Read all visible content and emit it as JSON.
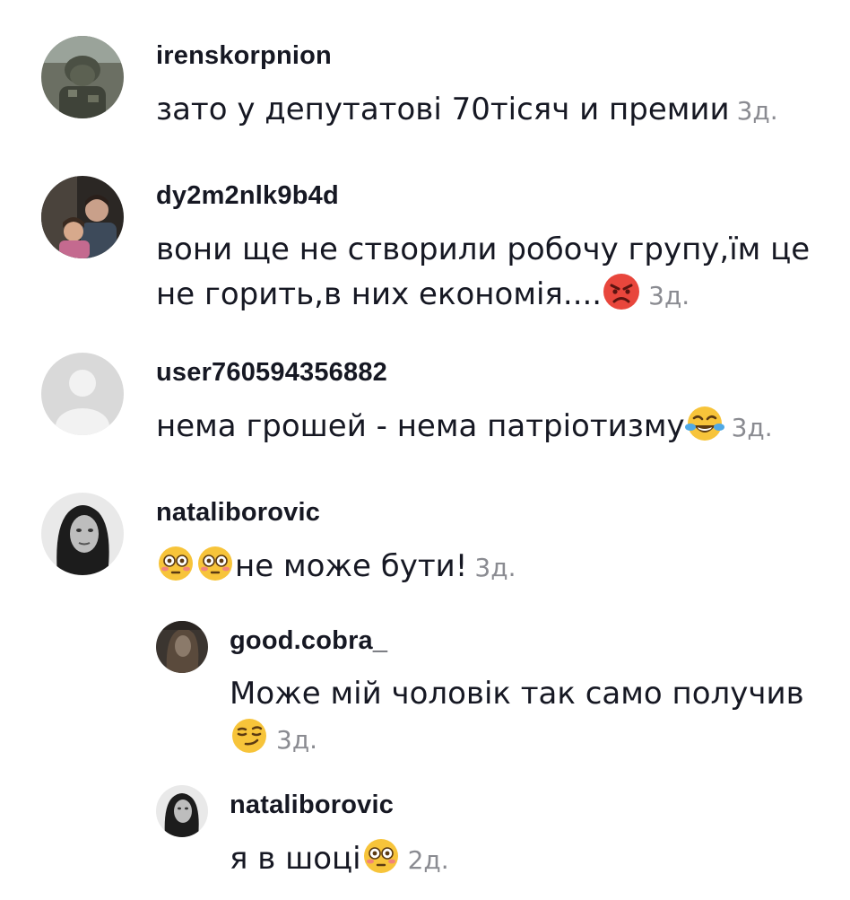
{
  "comments": [
    {
      "username": "irenskorpnion",
      "line1": "зато у депутатові 70тісяч и премии",
      "time": "3д."
    },
    {
      "username": "dy2m2nlk9b4d",
      "line1": "вони ще не створили робочу групу,їм це",
      "line2": "не горить,в них економія....",
      "emoji": "angry-face-emoji",
      "time": "3д."
    },
    {
      "username": "user760594356882",
      "line1": "нема грошей - нема патріотизму",
      "emoji": "tears-of-joy-emoji",
      "time": "3д."
    },
    {
      "username": "nataliborovic",
      "line1": "не може бути!",
      "emoji": "flushed-face-emoji",
      "time": "3д."
    }
  ],
  "replies": [
    {
      "username": "good.cobra_",
      "line1": "Може мій чоловік так само получив",
      "emoji": "smirking-face-emoji",
      "time": "3д."
    },
    {
      "username": "nataliborovic",
      "line1": "я в шоці",
      "emoji": "flushed-face-emoji",
      "time": "2д."
    }
  ],
  "colors": {
    "text": "#161823",
    "timestamp": "#8a8b91",
    "default_avatar_bg": "#d9d9d9"
  }
}
